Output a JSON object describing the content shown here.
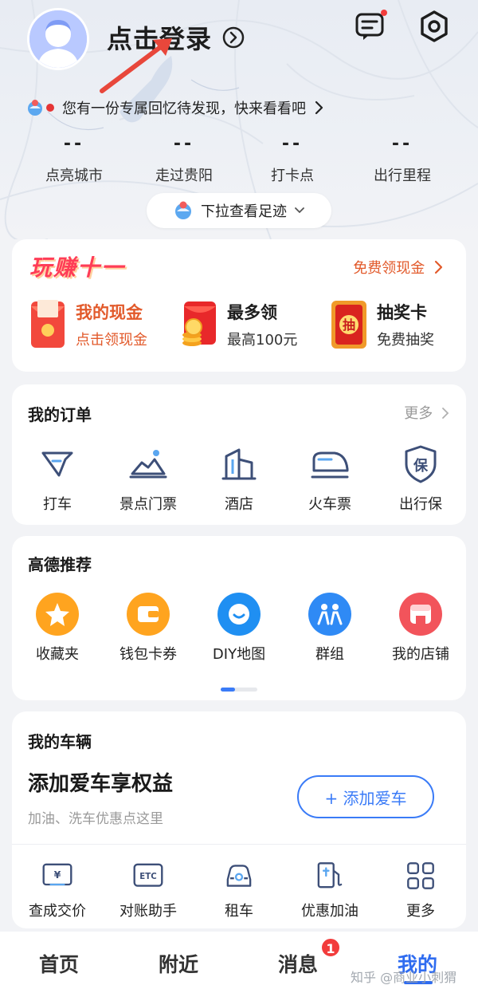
{
  "header": {
    "login_text": "点击登录",
    "memory_text": "您有一份专属回忆待发现，快来看看吧",
    "pull_text": "下拉查看足迹"
  },
  "stats": [
    {
      "value": "--",
      "label": "点亮城市"
    },
    {
      "value": "--",
      "label": "走过贵阳"
    },
    {
      "value": "--",
      "label": "打卡点"
    },
    {
      "value": "--",
      "label": "出行里程"
    }
  ],
  "promo": {
    "logo": "玩赚十一",
    "link": "免费领现金",
    "items": [
      {
        "title": "我的现金",
        "sub": "点击领现金",
        "icon": "red-envelope-icon"
      },
      {
        "title": "最多领",
        "sub": "最高100元",
        "icon": "coin-envelope-icon"
      },
      {
        "title": "抽奖卡",
        "sub": "免费抽奖",
        "icon": "lottery-card-icon"
      }
    ]
  },
  "orders": {
    "title": "我的订单",
    "more": "更多",
    "items": [
      {
        "label": "打车",
        "icon": "taxi-icon"
      },
      {
        "label": "景点门票",
        "icon": "scenic-ticket-icon"
      },
      {
        "label": "酒店",
        "icon": "hotel-icon"
      },
      {
        "label": "火车票",
        "icon": "train-icon"
      },
      {
        "label": "出行保",
        "icon": "insurance-icon"
      }
    ]
  },
  "recommend": {
    "title": "高德推荐",
    "items": [
      {
        "label": "收藏夹",
        "icon": "star-icon"
      },
      {
        "label": "钱包卡券",
        "icon": "wallet-icon"
      },
      {
        "label": "DIY地图",
        "icon": "diy-map-icon"
      },
      {
        "label": "群组",
        "icon": "group-icon"
      },
      {
        "label": "我的店铺",
        "icon": "shop-icon"
      }
    ]
  },
  "vehicle": {
    "title": "我的车辆",
    "headline": "添加爱车享权益",
    "sub": "加油、洗车优惠点这里",
    "button": "+ 添加爱车",
    "items": [
      {
        "label": "查成交价",
        "icon": "price-icon"
      },
      {
        "label": "对账助手",
        "icon": "etc-icon"
      },
      {
        "label": "租车",
        "icon": "car-icon"
      },
      {
        "label": "优惠加油",
        "icon": "fuel-icon"
      },
      {
        "label": "更多",
        "icon": "grid-icon"
      }
    ]
  },
  "tabs": [
    {
      "label": "首页"
    },
    {
      "label": "附近"
    },
    {
      "label": "消息",
      "badge": "1"
    },
    {
      "label": "我的"
    }
  ],
  "watermark": "知乎 @商业小刺猬",
  "colors": {
    "accent": "#2f6cf0",
    "promo_red": "#ff3d57",
    "badge": "#f23c3c"
  }
}
